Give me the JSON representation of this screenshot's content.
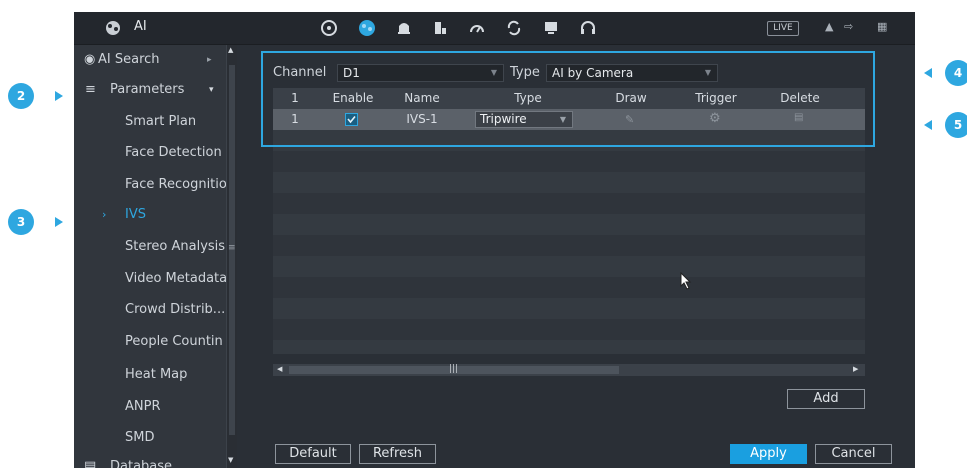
{
  "app": {
    "title": "AI",
    "live_label": "LIVE"
  },
  "sidebar": {
    "ai_search": "AI Search",
    "parameters": "Parameters",
    "items": [
      "Smart Plan",
      "Face Detection",
      "Face Recognitio",
      "IVS",
      "Stereo Analysis",
      "Video Metadata",
      "Crowd Distrib...",
      "People Countin",
      "Heat Map",
      "ANPR",
      "SMD"
    ],
    "active_item": "IVS",
    "database": "Database"
  },
  "filters": {
    "channel_label": "Channel",
    "channel_value": "D1",
    "type_label": "Type",
    "type_value": "AI by Camera"
  },
  "table": {
    "columns": [
      "1",
      "Enable",
      "Name",
      "Type",
      "Draw",
      "Trigger",
      "Delete"
    ],
    "rows": [
      {
        "index": "1",
        "enabled": true,
        "name": "IVS-1",
        "type": "Tripwire"
      }
    ]
  },
  "buttons": {
    "add": "Add",
    "default": "Default",
    "refresh": "Refresh",
    "apply": "Apply",
    "cancel": "Cancel"
  },
  "callouts": [
    "2",
    "3",
    "4",
    "5"
  ],
  "colors": {
    "accent": "#2ea7e0",
    "apply_button": "#1a9fe0",
    "background": "#2a2f36"
  }
}
